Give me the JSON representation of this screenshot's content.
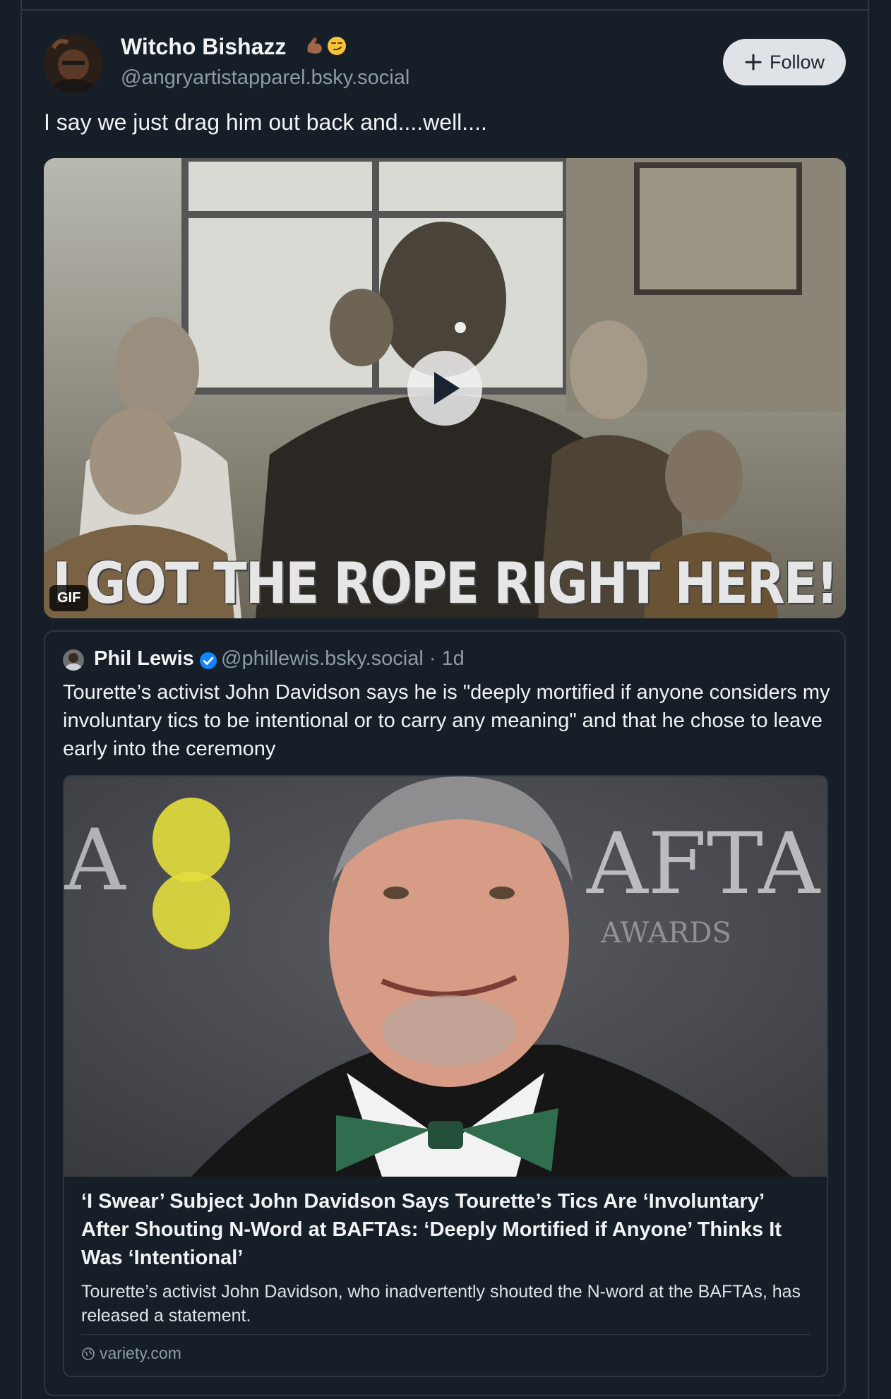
{
  "post": {
    "display_name": "Witcho Bishazz",
    "name_emojis": [
      "flexed-biceps-emoji",
      "smirking-face-emoji"
    ],
    "handle": "@angryartistapparel.bsky.social",
    "follow_label": "Follow",
    "text": "I say we just drag him out back and....well....",
    "gif": {
      "badge": "GIF",
      "caption": "I GOT THE ROPE RIGHT HERE!"
    }
  },
  "quote": {
    "display_name": "Phil Lewis",
    "verified": true,
    "handle": "@phillewis.bsky.social",
    "separator": "·",
    "time": "1d",
    "handle_time": "@phillewis.bsky.social · 1d",
    "text": "Tourette’s activist John Davidson says he is \"deeply mortified if anyone considers my involuntary tics to be intentional or to carry any meaning\" and that he chose to leave early into the ceremony",
    "link_card": {
      "title": "‘I Swear’ Subject John Davidson Says Tourette’s Tics Are ‘Involuntary’ After Shouting N-Word at BAFTAs: ‘Deeply Mortified if Anyone’ Thinks It Was ‘Intentional’",
      "description": "Tourette’s activist John Davidson, who inadvertently shouted the N-word at the BAFTAs, has released a statement.",
      "domain": "variety.com",
      "image_backdrop_text": "AFTA",
      "image_backdrop_sub": "AWARDS"
    }
  },
  "colors": {
    "background": "#161e27",
    "border": "#2c3844",
    "muted_text": "#8d9aa8",
    "verified_blue": "#1083fe",
    "follow_bg": "#dfe3e8"
  }
}
